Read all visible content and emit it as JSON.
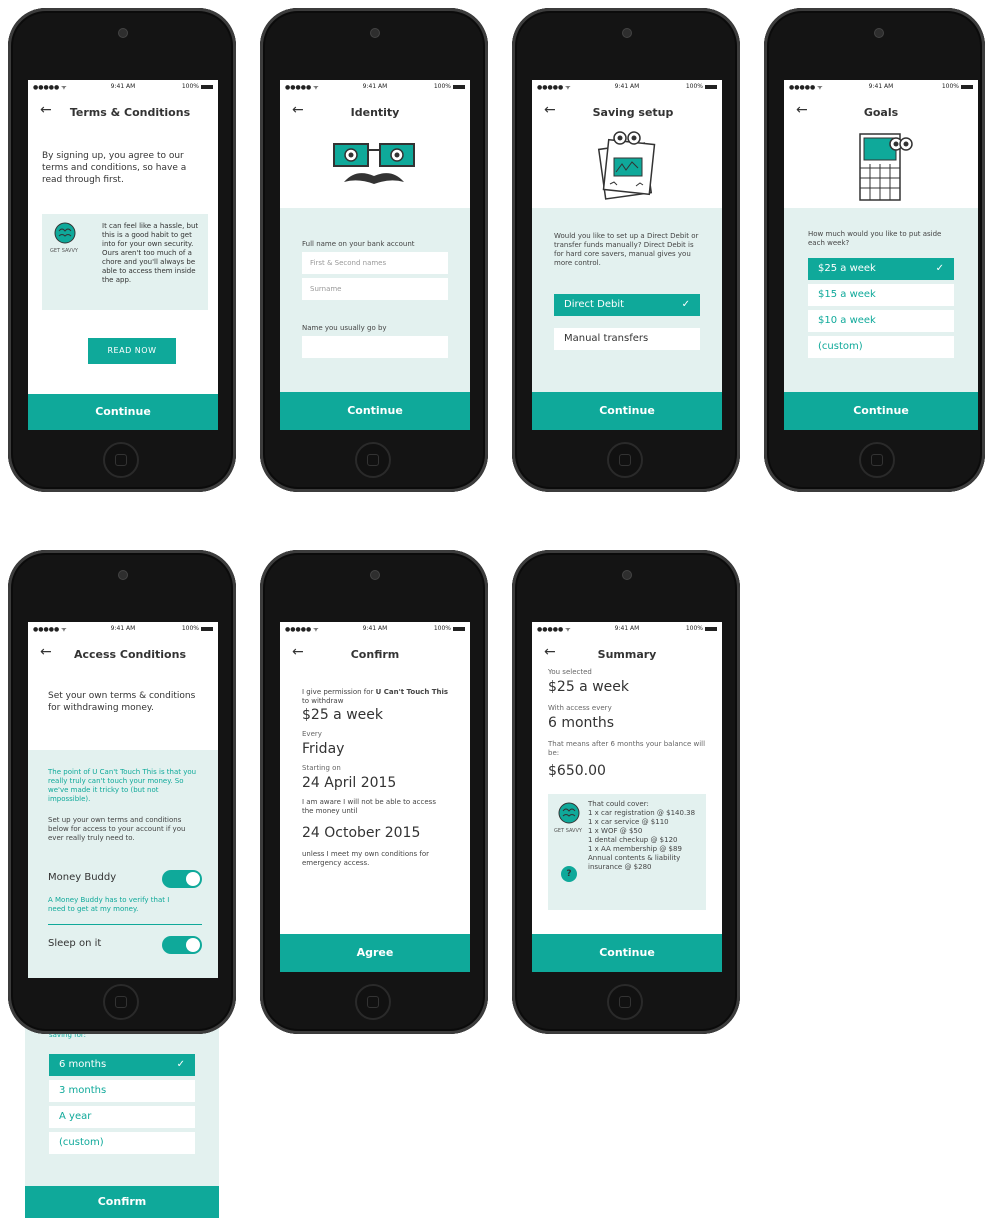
{
  "status": {
    "carrier": "●●●●● ᯤ",
    "time": "9:41 AM",
    "battery": "100%"
  },
  "screens": {
    "terms": {
      "title": "Terms & Conditions",
      "intro": "By signing up, you agree to our terms and conditions, so have a read through first.",
      "tip_badge": "GET SAVVY",
      "tip": "It can feel like a hassle, but this is a good habit to get into for your own security. Ours aren't too much of a chore and you'll always be able to access them inside the app.",
      "read_button": "READ NOW",
      "cta": "Continue"
    },
    "identity": {
      "title": "Identity",
      "full_name_label": "Full name on your bank account",
      "first_placeholder": "First & Second names",
      "surname_placeholder": "Surname",
      "nickname_label": "Name you usually go by",
      "cta": "Continue"
    },
    "saving": {
      "title": "Saving setup",
      "question": "Would you like to set up a Direct Debit or transfer funds manually? Direct Debit is for hard core savers, manual gives you more control.",
      "options": [
        "Direct Debit",
        "Manual transfers"
      ],
      "check": "✓",
      "cta": "Continue"
    },
    "goals": {
      "title": "Goals",
      "question": "How much would you like to put aside each week?",
      "options": [
        "$25 a week",
        "$15 a week",
        "$10 a week",
        "(custom)"
      ],
      "check": "✓",
      "cta": "Continue"
    },
    "access": {
      "title": "Access Conditions",
      "intro": "Set your own terms & conditions for withdrawing money.",
      "point": "The point of U Can't Touch This is that you really truly can't touch your money. So we've made it tricky to (but not impossible).",
      "setup": "Set up your own terms and conditions below for access to your account if you ever really truly need to.",
      "buddy_label": "Money Buddy",
      "buddy_note": "A Money Buddy has to verify that I need to get at my money.",
      "sleep_label": "Sleep on it",
      "until_label": "I can't touch my money until I have been saving for:",
      "options": [
        "6 months",
        "3 months",
        "A year",
        "(custom)"
      ],
      "check": "✓",
      "cta": "Confirm"
    },
    "confirm": {
      "title": "Confirm",
      "perm_pre": "I give permission for ",
      "perm_bold": "U Can't Touch This",
      "perm_post": " to withdraw",
      "amount": "$25 a week",
      "every_label": "Every",
      "every": "Friday",
      "start_label": "Starting on",
      "start": "24 April 2015",
      "aware": "I am aware I will not be able to access the money until",
      "until": "24 October 2015",
      "unless": "unless I meet my own conditions for emergency access.",
      "cta": "Agree"
    },
    "summary": {
      "title": "Summary",
      "selected_label": "You selected",
      "selected": "$25 a week",
      "access_label": "With access every",
      "access": "6 months",
      "means_label": "That means after 6 months your balance will be:",
      "balance": "$650.00",
      "tip_badge": "GET SAVVY",
      "cover_title": "That could cover:",
      "cover": [
        "1 x car registration @ $140.38",
        "1 x car service @ $110",
        "1 x WOF @ $50",
        "1 dental checkup @ $120",
        "1 x AA membership @ $89",
        "Annual contents & liability insurance @ $280"
      ],
      "help": "?",
      "cta": "Continue"
    }
  },
  "back": "←",
  "colors": {
    "accent": "#0fa99a",
    "panel": "#e3f1ef"
  }
}
